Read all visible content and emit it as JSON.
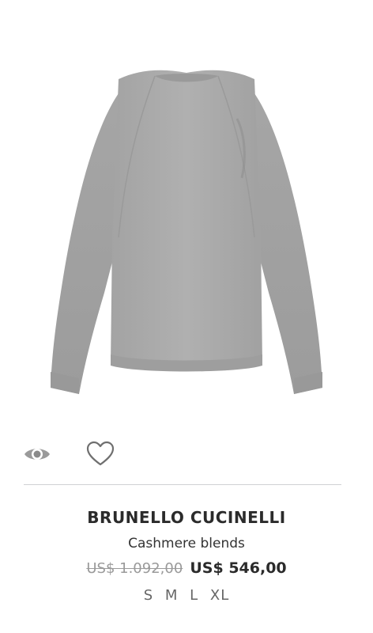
{
  "product": {
    "brand": "BRUNELLO CUCINELLI",
    "description": "Cashmere blends",
    "original_price": "US$ 1.092,00",
    "sale_price": "US$ 546,00",
    "sizes": [
      "S",
      "M",
      "L",
      "XL"
    ]
  },
  "actions": {
    "quick_view_icon": "eye-icon",
    "wishlist_icon": "heart-icon"
  },
  "colors": {
    "sweater": "#a9a9a9",
    "text": "#2b2b2b",
    "muted": "#9a9a9a",
    "divider": "#cfd1d4"
  }
}
